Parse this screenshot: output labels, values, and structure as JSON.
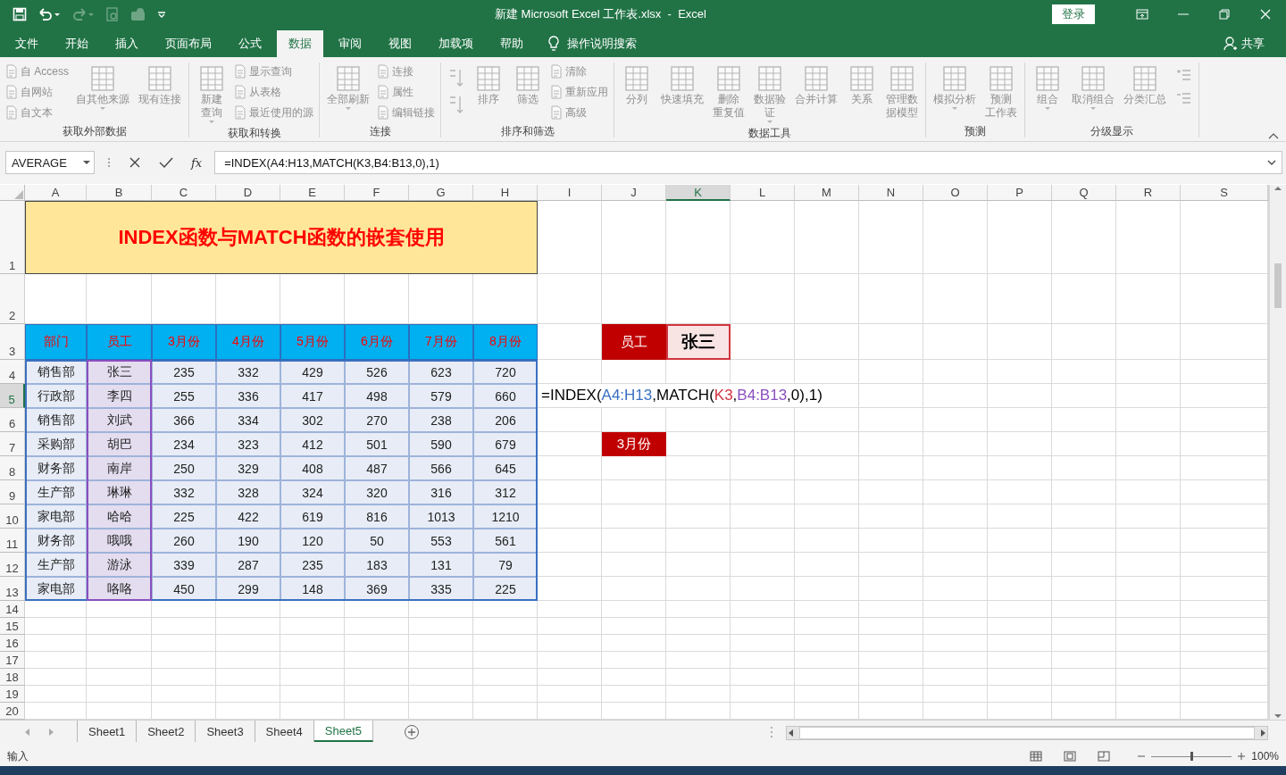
{
  "window": {
    "title": "新建 Microsoft Excel 工作表.xlsx  -  Excel",
    "login": "登录"
  },
  "menu": {
    "tabs": [
      {
        "label": "文件",
        "selected": false
      },
      {
        "label": "开始",
        "selected": false
      },
      {
        "label": "插入",
        "selected": false
      },
      {
        "label": "页面布局",
        "selected": false
      },
      {
        "label": "公式",
        "selected": false
      },
      {
        "label": "数据",
        "selected": true
      },
      {
        "label": "审阅",
        "selected": false
      },
      {
        "label": "视图",
        "selected": false
      },
      {
        "label": "加载项",
        "selected": false
      },
      {
        "label": "帮助",
        "selected": false
      }
    ],
    "search": "操作说明搜索",
    "share": "共享"
  },
  "ribbon": {
    "groups": [
      {
        "label": "获取外部数据",
        "columns": [
          {
            "kind": "stack",
            "items": [
              "自 Access",
              "自网站",
              "自文本"
            ]
          },
          {
            "kind": "large",
            "label": "自其他来源",
            "dropdown": true
          },
          {
            "kind": "large",
            "label": "现有连接",
            "dropdown": false
          }
        ]
      },
      {
        "label": "获取和转换",
        "columns": [
          {
            "kind": "large",
            "lines": [
              "新建",
              "查询"
            ],
            "dropdown": true
          },
          {
            "kind": "stack",
            "items": [
              "显示查询",
              "从表格",
              "最近使用的源"
            ]
          }
        ]
      },
      {
        "label": "连接",
        "columns": [
          {
            "kind": "large",
            "label": "全部刷新",
            "dropdown": true
          },
          {
            "kind": "stack",
            "items": [
              "连接",
              "属性",
              "编辑链接"
            ]
          }
        ]
      },
      {
        "label": "排序和筛选",
        "columns": [
          {
            "kind": "sort"
          },
          {
            "kind": "large",
            "label": "排序",
            "dropdown": false
          },
          {
            "kind": "large",
            "label": "筛选",
            "dropdown": false
          },
          {
            "kind": "stack",
            "items": [
              "清除",
              "重新应用",
              "高级"
            ]
          }
        ]
      },
      {
        "label": "数据工具",
        "columns": [
          {
            "kind": "large",
            "label": "分列",
            "dropdown": false
          },
          {
            "kind": "large",
            "label": "快速填充",
            "dropdown": false
          },
          {
            "kind": "large",
            "lines": [
              "删除",
              "重复值"
            ],
            "dropdown": false
          },
          {
            "kind": "large",
            "lines": [
              "数据验",
              "证"
            ],
            "dropdown": true
          },
          {
            "kind": "large",
            "label": "合并计算",
            "dropdown": false
          },
          {
            "kind": "large",
            "label": "关系",
            "dropdown": false
          },
          {
            "kind": "large",
            "lines": [
              "管理数",
              "据模型"
            ],
            "dropdown": false
          }
        ]
      },
      {
        "label": "预测",
        "columns": [
          {
            "kind": "large",
            "label": "模拟分析",
            "dropdown": true
          },
          {
            "kind": "large",
            "lines": [
              "预测",
              "工作表"
            ],
            "dropdown": false
          }
        ]
      },
      {
        "label": "分级显示",
        "columns": [
          {
            "kind": "large",
            "label": "组合",
            "dropdown": true
          },
          {
            "kind": "large",
            "label": "取消组合",
            "dropdown": true
          },
          {
            "kind": "large",
            "label": "分类汇总",
            "dropdown": false
          },
          {
            "kind": "icons"
          }
        ]
      }
    ]
  },
  "formula_bar": {
    "name_box": "AVERAGE",
    "function_label": "fx",
    "formula": "=INDEX(A4:H13,MATCH(K3,B4:B13,0),1)"
  },
  "sheet": {
    "columns": [
      {
        "label": "A",
        "selected": false
      },
      {
        "label": "B",
        "selected": false
      },
      {
        "label": "C",
        "selected": false
      },
      {
        "label": "D",
        "selected": false
      },
      {
        "label": "E",
        "selected": false
      },
      {
        "label": "F",
        "selected": false
      },
      {
        "label": "G",
        "selected": false
      },
      {
        "label": "H",
        "selected": false
      },
      {
        "label": "I",
        "selected": false
      },
      {
        "label": "J",
        "selected": false
      },
      {
        "label": "K",
        "selected": true
      },
      {
        "label": "L",
        "selected": false
      },
      {
        "label": "M",
        "selected": false
      },
      {
        "label": "N",
        "selected": false
      },
      {
        "label": "O",
        "selected": false
      },
      {
        "label": "P",
        "selected": false
      },
      {
        "label": "Q",
        "selected": false
      },
      {
        "label": "R",
        "selected": false
      },
      {
        "label": "S",
        "selected": false
      }
    ],
    "rows": [
      {
        "label": "1",
        "selected": false
      },
      {
        "label": "2",
        "selected": false
      },
      {
        "label": "3",
        "selected": false
      },
      {
        "label": "4",
        "selected": false
      },
      {
        "label": "5",
        "selected": true
      },
      {
        "label": "6",
        "selected": false
      },
      {
        "label": "7",
        "selected": false
      },
      {
        "label": "8",
        "selected": false
      },
      {
        "label": "9",
        "selected": false
      },
      {
        "label": "10",
        "selected": false
      },
      {
        "label": "11",
        "selected": false
      },
      {
        "label": "12",
        "selected": false
      },
      {
        "label": "13",
        "selected": false
      },
      {
        "label": "14",
        "selected": false
      },
      {
        "label": "15",
        "selected": false
      },
      {
        "label": "16",
        "selected": false
      },
      {
        "label": "17",
        "selected": false
      },
      {
        "label": "18",
        "selected": false
      },
      {
        "label": "19",
        "selected": false
      },
      {
        "label": "20",
        "selected": false
      }
    ],
    "title": "INDEX函数与MATCH函数的嵌套使用",
    "table": {
      "header": [
        "部门",
        "员工",
        "3月份",
        "4月份",
        "5月份",
        "6月份",
        "7月份",
        "8月份"
      ],
      "rows": [
        [
          "销售部",
          "张三",
          "235",
          "332",
          "429",
          "526",
          "623",
          "720"
        ],
        [
          "行政部",
          "李四",
          "255",
          "336",
          "417",
          "498",
          "579",
          "660"
        ],
        [
          "销售部",
          "刘武",
          "366",
          "334",
          "302",
          "270",
          "238",
          "206"
        ],
        [
          "采购部",
          "胡巴",
          "234",
          "323",
          "412",
          "501",
          "590",
          "679"
        ],
        [
          "财务部",
          "南岸",
          "250",
          "329",
          "408",
          "487",
          "566",
          "645"
        ],
        [
          "生产部",
          "琳琳",
          "332",
          "328",
          "324",
          "320",
          "316",
          "312"
        ],
        [
          "家电部",
          "哈哈",
          "225",
          "422",
          "619",
          "816",
          "1013",
          "1210"
        ],
        [
          "财务部",
          "哦哦",
          "260",
          "190",
          "120",
          "50",
          "553",
          "561"
        ],
        [
          "生产部",
          "游泳",
          "339",
          "287",
          "235",
          "183",
          "131",
          "79"
        ],
        [
          "家电部",
          "咯咯",
          "450",
          "299",
          "148",
          "369",
          "335",
          "225"
        ]
      ]
    },
    "lookup": {
      "label": "员工",
      "value": "张三",
      "result_label": "3月份"
    },
    "formula_parts": [
      {
        "text": "=INDEX("
      },
      {
        "text": "A4:H13",
        "color": "#3a70c0"
      },
      {
        "text": ",MATCH("
      },
      {
        "text": "K3",
        "color": "#d0353f"
      },
      {
        "text": ","
      },
      {
        "text": "B4:B13",
        "color": "#8a4fbf"
      },
      {
        "text": ",0),1)"
      }
    ]
  },
  "sheet_tabs": [
    {
      "label": "Sheet1",
      "selected": false
    },
    {
      "label": "Sheet2",
      "selected": false
    },
    {
      "label": "Sheet3",
      "selected": false
    },
    {
      "label": "Sheet4",
      "selected": false
    },
    {
      "label": "Sheet5",
      "selected": true
    }
  ],
  "status_bar": {
    "mode": "输入",
    "zoom": {
      "level": 0.5,
      "reading": "100%"
    }
  }
}
